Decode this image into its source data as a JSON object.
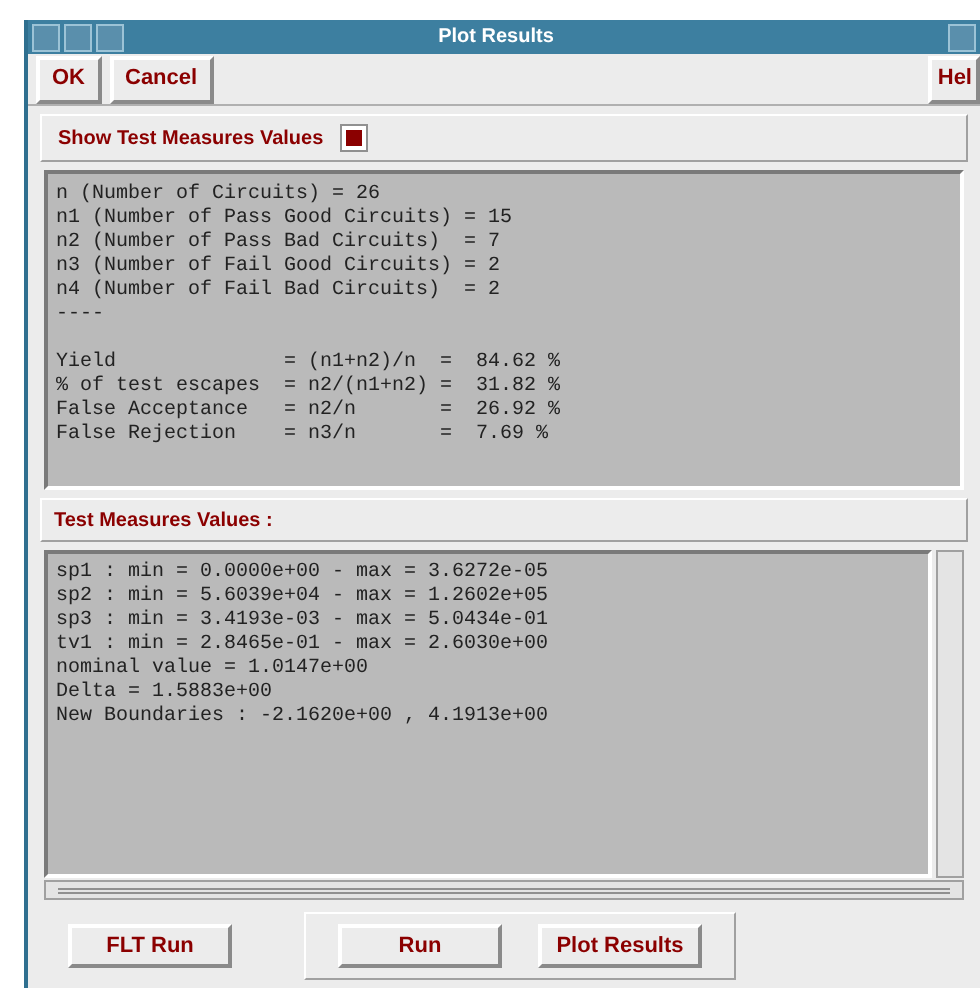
{
  "window": {
    "title": "Plot Results"
  },
  "toolbar": {
    "buttons": [
      "OK",
      "Cancel"
    ],
    "help_button": "Hel"
  },
  "show_values": {
    "label": "Show Test Measures Values",
    "checked": true
  },
  "summary": {
    "counts": [
      "n (Number of Circuits) = 26",
      "n1 (Number of Pass Good Circuits) = 15",
      "n2 (Number of Pass Bad Circuits)  = 7",
      "n3 (Number of Fail Good Circuits) = 2",
      "n4 (Number of Fail Bad Circuits)  = 2",
      "----"
    ],
    "rates": [
      "Yield              = (n1+n2)/n  =  84.62 %",
      "% of test escapes  = n2/(n1+n2) =  31.82 %",
      "False Acceptance   = n2/n       =  26.92 %",
      "False Rejection    = n3/n       =  7.69 %"
    ]
  },
  "measures": {
    "title": "Test Measures Values :",
    "lines": [
      "sp1 : min = 0.0000e+00 - max = 3.6272e-05",
      "sp2 : min = 5.6039e+04 - max = 1.2602e+05",
      "sp3 : min = 3.4193e-03 - max = 5.0434e-01",
      "tv1 : min = 2.8465e-01 - max = 2.6030e+00",
      "nominal value = 1.0147e+00",
      "Delta = 1.5883e+00",
      "New Boundaries : -2.1620e+00 , 4.1913e+00"
    ]
  },
  "bottom_buttons": {
    "left": "FLT Run",
    "group": [
      "Run",
      "Plot Results"
    ]
  }
}
